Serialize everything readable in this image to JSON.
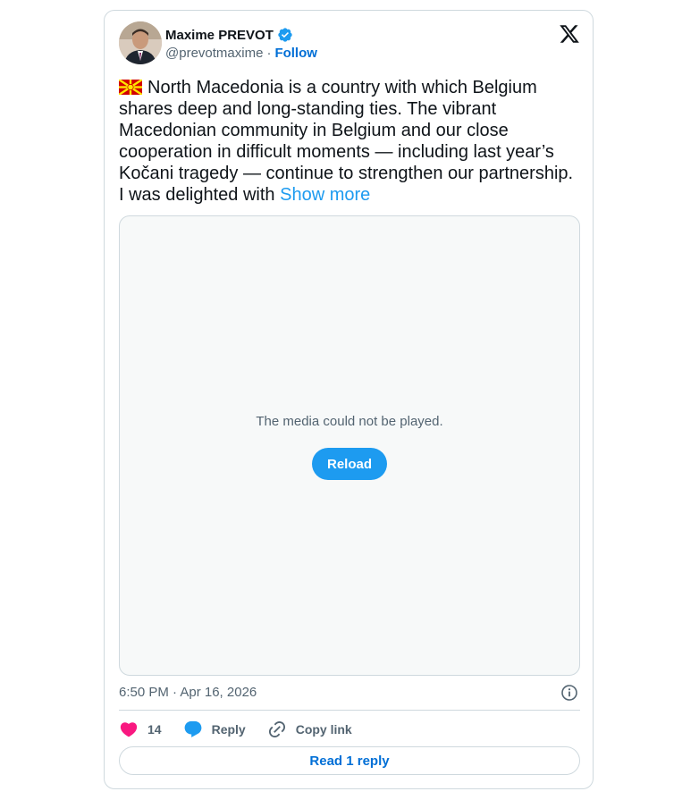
{
  "author": {
    "name": "Maxime PREVOT",
    "handle": "@prevotmaxime",
    "separator": "·",
    "follow_label": "Follow"
  },
  "tweet": {
    "flag_icon": "flag-north-macedonia-icon",
    "text": "North Macedonia is a country with which Belgium shares deep and long-standing ties. The vibrant Macedonian community in Belgium and our close cooperation in difficult moments — including last year’s Kočani tragedy — continue to strengthen our partnership. I was delighted with ",
    "show_more_label": "Show more"
  },
  "media": {
    "message": "The media could not be played.",
    "reload_label": "Reload"
  },
  "meta": {
    "timestamp": "6:50 PM · Apr 16, 2026"
  },
  "actions": {
    "like_count": "14",
    "reply_label": "Reply",
    "copy_link_label": "Copy link"
  },
  "read_replies_label": "Read 1 reply",
  "colors": {
    "accent": "#1d9bf0",
    "link": "#006fd6",
    "like": "#f91880",
    "verified": "#1d9bf0"
  }
}
